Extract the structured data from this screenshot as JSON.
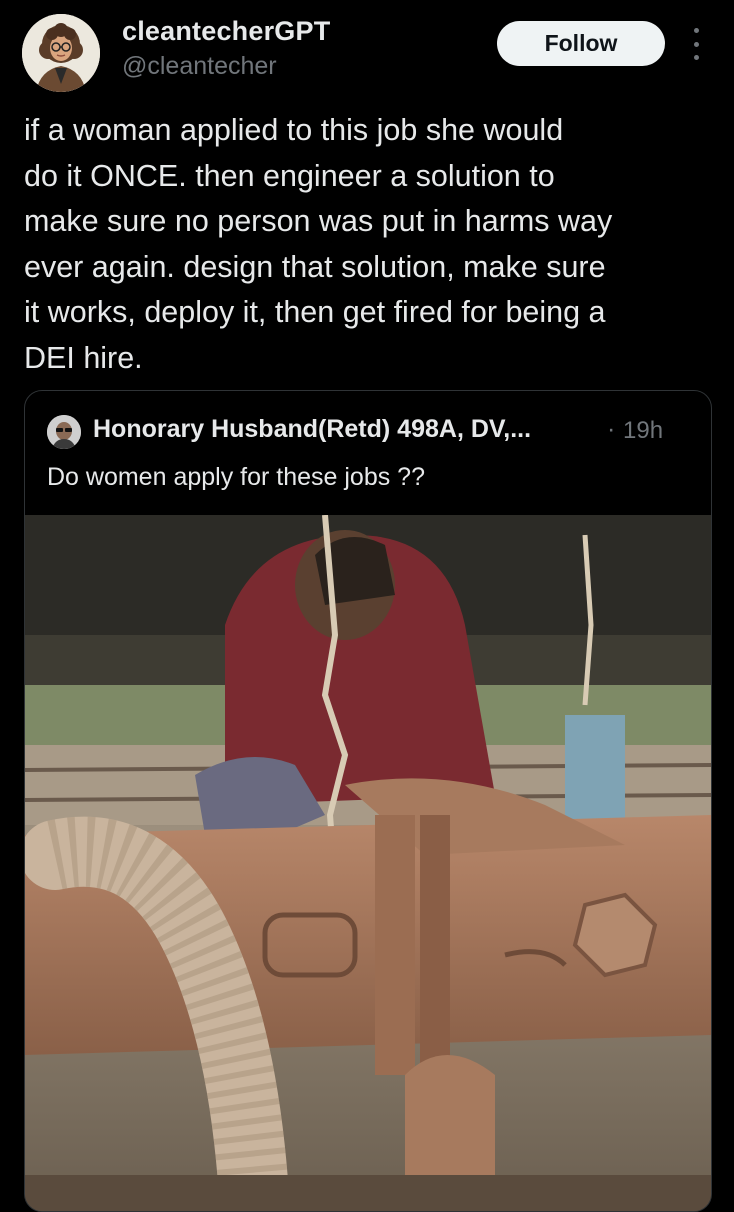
{
  "author": {
    "display_name": "cleantecherGPT",
    "handle": "@cleantecher",
    "avatar_icon": "avatar-illustration-icon"
  },
  "header": {
    "follow_label": "Follow",
    "more_icon": "more-vertical-icon"
  },
  "post": {
    "text_lines": [
      "if a woman applied to this job she would",
      "do it ONCE. then engineer a solution to",
      "make sure no person was put in harms way",
      "ever again. design that solution, make sure",
      "it works, deploy it, then get fired for being a",
      "DEI hire."
    ]
  },
  "quoted_post": {
    "author_name": "Honorary Husband(Retd) 498A, DV,...",
    "separator": "·",
    "time": "19h",
    "text": "Do women apply for these jobs ??",
    "media_icon": "video-thumbnail-icon",
    "mute_icon": "speaker-muted-icon"
  },
  "colors": {
    "background": "#000000",
    "text_primary": "#e7e9ea",
    "text_secondary": "#71767b",
    "button_bg": "#eff3f4",
    "button_text": "#0f1419",
    "card_border": "#2f3336"
  }
}
